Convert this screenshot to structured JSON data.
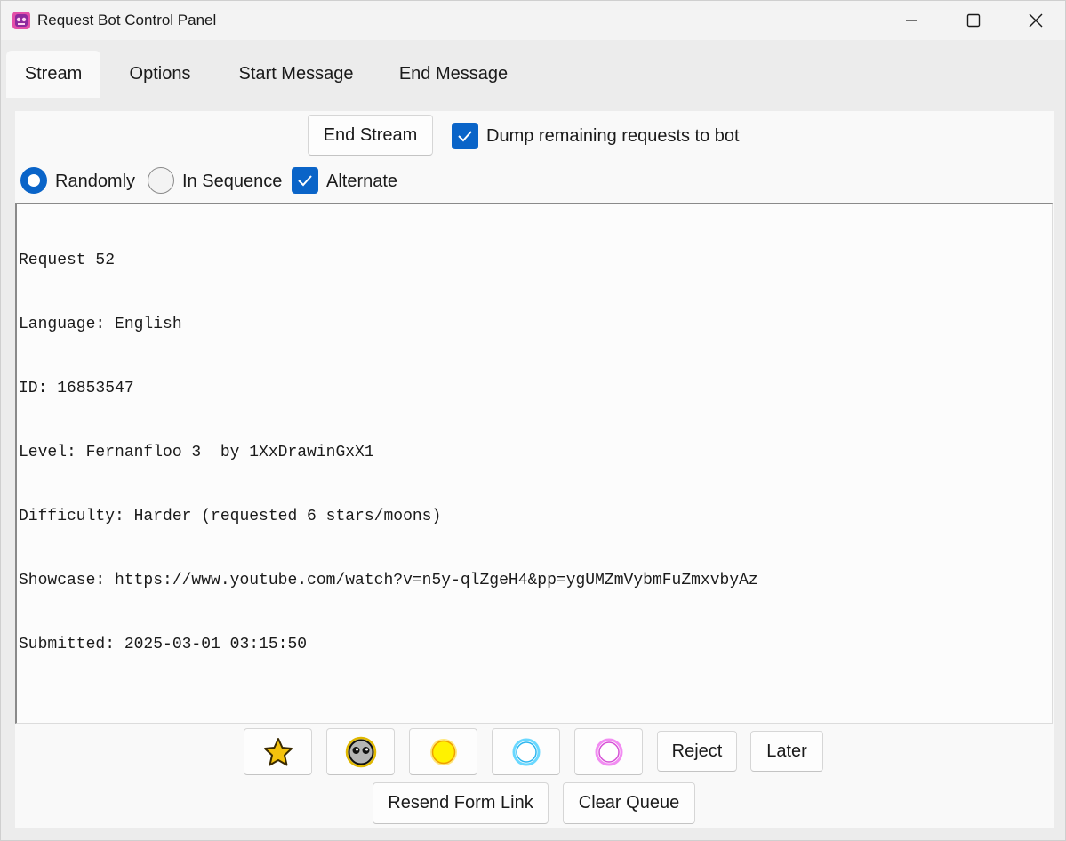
{
  "window": {
    "title": "Request Bot Control Panel",
    "icon": "app-icon"
  },
  "tabs": [
    {
      "label": "Stream",
      "active": true
    },
    {
      "label": "Options",
      "active": false
    },
    {
      "label": "Start Message",
      "active": false
    },
    {
      "label": "End Message",
      "active": false
    }
  ],
  "stream": {
    "end_stream_label": "End Stream",
    "dump_label": "Dump remaining requests to bot",
    "dump_checked": true,
    "order": {
      "randomly_label": "Randomly",
      "in_sequence_label": "In Sequence",
      "selected": "Randomly",
      "alternate_label": "Alternate",
      "alternate_checked": true
    },
    "request_lines": [
      "Request 52",
      "Language: English",
      "ID: 16853547",
      "Level: Fernanfloo 3  by 1XxDrawinGxX1",
      "Difficulty: Harder (requested 6 stars/moons)",
      "Showcase: https://www.youtube.com/watch?v=n5y-qlZgeH4&pp=ygUMZmVybmFuZmxvbyAz",
      "Submitted: 2025-03-01 03:15:50"
    ],
    "rating_buttons": [
      "star-icon",
      "face-icon",
      "yellow-orb-icon",
      "cyan-orb-icon",
      "pink-orb-icon"
    ],
    "reject_label": "Reject",
    "later_label": "Later",
    "resend_label": "Resend Form Link",
    "clear_label": "Clear Queue"
  },
  "colors": {
    "accent": "#0a64c8",
    "panel": "#f9f9f9",
    "window": "#ececec"
  }
}
